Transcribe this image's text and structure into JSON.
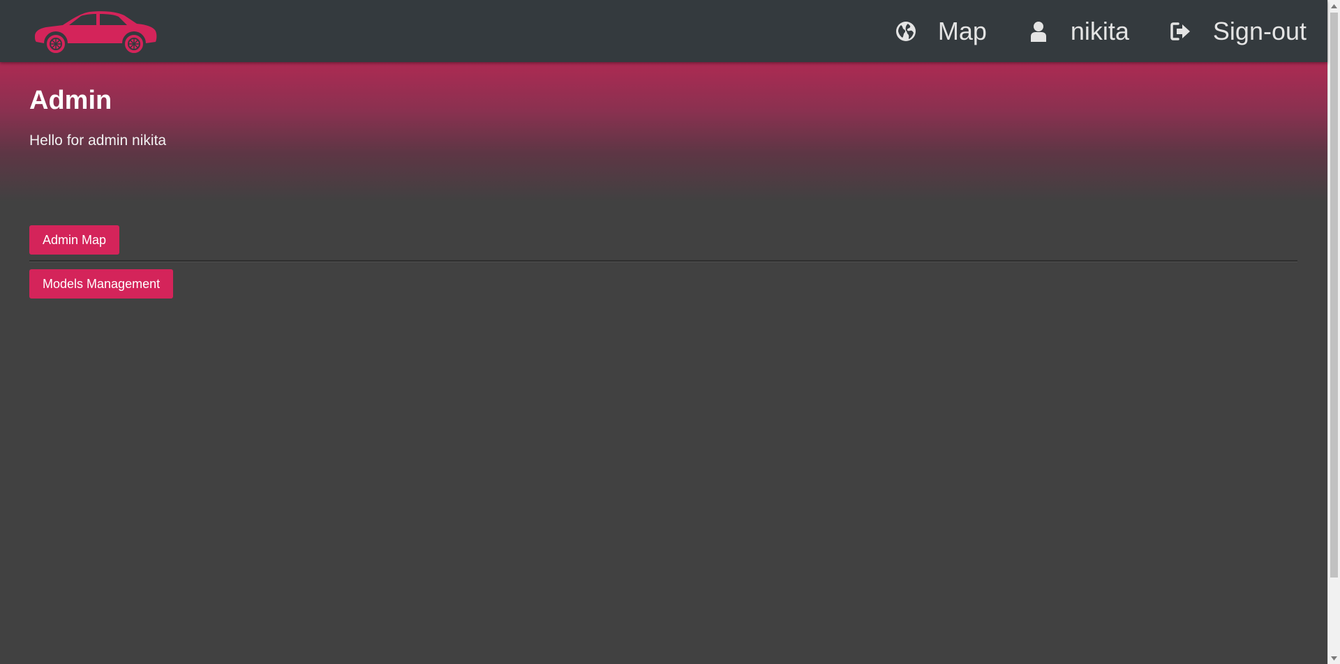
{
  "navbar": {
    "logo_name": "car-logo",
    "items": [
      {
        "label": "Map",
        "icon": "globe-icon"
      },
      {
        "label": "nikita",
        "icon": "user-icon"
      },
      {
        "label": "Sign-out",
        "icon": "sign-out-icon"
      }
    ]
  },
  "hero": {
    "title": "Admin",
    "subtitle": "Hello for admin nikita"
  },
  "buttons": {
    "admin_map": "Admin Map",
    "models_management": "Models Management"
  },
  "colors": {
    "navbar_bg": "#343a3e",
    "accent": "#d4245a",
    "page_bg": "#414141"
  }
}
